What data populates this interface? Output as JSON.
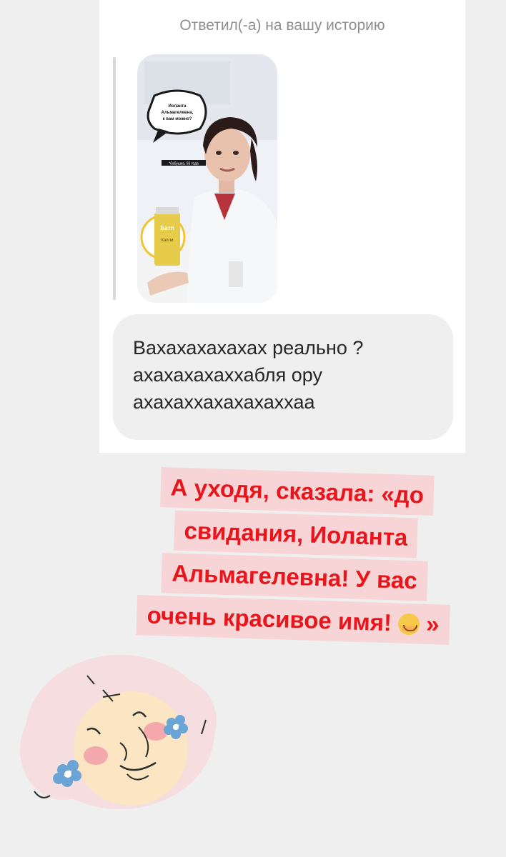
{
  "reply": {
    "header": "Ответил(-а) на вашу историю"
  },
  "story": {
    "sticker_text": "Иоланта Альмагелевна, к вам можно?",
    "label_text": "*бабушка, 93 года",
    "product_text": "Батп",
    "product_label": "Капли"
  },
  "message": {
    "text": "Вахахахахахах реально ?\nахахахахаххабля ору\nахахаххахахахаххаа"
  },
  "caption": {
    "line1": "А уходя, сказала: «до",
    "line2": "свидания, Иоланта",
    "line3": "Альмагелевна! У вас",
    "line4": "очень красивое имя!",
    "closing": "»",
    "emoji": "smiling-face-icon"
  },
  "colors": {
    "caption_text": "#e8161c",
    "caption_bg": "#f7d4d5",
    "page_bg": "#efefef",
    "bubble_bg": "#efefef"
  }
}
